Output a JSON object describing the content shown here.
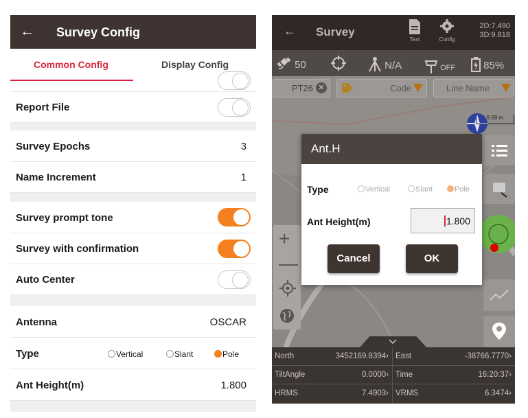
{
  "left": {
    "header": {
      "back_icon": "arrow-left-icon",
      "title": "Survey Config"
    },
    "tabs": [
      {
        "label": "Common Config",
        "active": true
      },
      {
        "label": "Display Config",
        "active": false
      }
    ],
    "rows": {
      "report_file": {
        "label": "Report File",
        "toggle": "off"
      },
      "survey_epochs": {
        "label": "Survey Epochs",
        "value": "3"
      },
      "name_increment": {
        "label": "Name Increment",
        "value": "1"
      },
      "survey_prompt_tone": {
        "label": "Survey prompt tone",
        "toggle": "on"
      },
      "survey_with_confirmation": {
        "label": "Survey with confirmation",
        "toggle": "on"
      },
      "auto_center": {
        "label": "Auto Center",
        "toggle": "off"
      },
      "antenna": {
        "label": "Antenna",
        "value": "OSCAR"
      },
      "type": {
        "label": "Type",
        "options": [
          "Vertical",
          "Slant",
          "Pole"
        ],
        "selected": "Pole"
      },
      "ant_height": {
        "label": "Ant Height(m)",
        "value": "1.800"
      }
    },
    "accent_color": "#d8253b",
    "toggle_on_color": "#f4801f"
  },
  "right": {
    "header": {
      "back_icon": "arrow-left-icon",
      "title": "Survey",
      "text_button": {
        "label": "Text",
        "icon": "document-icon"
      },
      "config_button": {
        "label": "Config",
        "icon": "gear-icon"
      },
      "dop_2d": "2D:7.490",
      "dop_3d": "3D:9.818"
    },
    "status": {
      "satellites": "50",
      "rtk": "N/A",
      "radio": "OFF",
      "battery": "85%"
    },
    "inputs": {
      "point_name": "PT26",
      "code_placeholder": "Code",
      "line_name_placeholder": "Line Name"
    },
    "scale": "9.69 m",
    "dialog": {
      "title": "Ant.H",
      "type_label": "Type",
      "options": [
        "Vertical",
        "Slant",
        "Pole"
      ],
      "selected": "Pole",
      "height_label": "Ant Height(m)",
      "height_value": "1.800",
      "cancel": "Cancel",
      "ok": "OK"
    },
    "table": [
      {
        "k1": "North",
        "v1": "3452169.8394",
        "k2": "East",
        "v2": "-38766.7770"
      },
      {
        "k1": "TiltAngle",
        "v1": "0.0000",
        "k2": "Time",
        "v2": "16:20:37"
      },
      {
        "k1": "HRMS",
        "v1": "7.4903",
        "k2": "VRMS",
        "v2": "6.3474"
      }
    ]
  }
}
